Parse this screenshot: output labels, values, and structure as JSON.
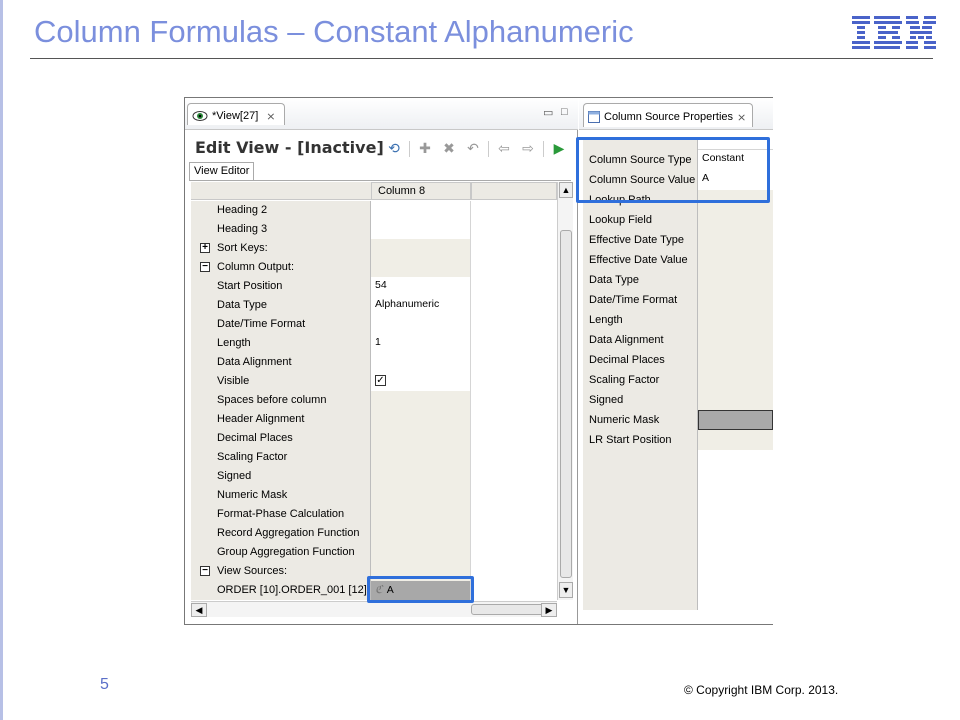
{
  "slide": {
    "title": "Column Formulas – Constant Alphanumeric",
    "logo": "IBM",
    "page_number": "5",
    "copyright": "© Copyright  IBM Corp.  2013."
  },
  "editor": {
    "tab_label": "*View[27]",
    "tab_close": "⨯",
    "title": "Edit View - [Inactive]",
    "subtab": "View Editor",
    "column_header": "Column 8",
    "rows": [
      {
        "label": "Heading 2",
        "value": "",
        "shaded": false
      },
      {
        "label": "Heading 3",
        "value": "",
        "shaded": false
      },
      {
        "label": "Sort Keys:",
        "value": "",
        "shaded": true,
        "toggle": "+"
      },
      {
        "label": "Column Output:",
        "value": "",
        "shaded": true,
        "toggle": "−"
      },
      {
        "label": "Start Position",
        "value": "54",
        "shaded": false
      },
      {
        "label": "Data Type",
        "value": "Alphanumeric",
        "shaded": false
      },
      {
        "label": "Date/Time Format",
        "value": "",
        "shaded": false
      },
      {
        "label": "Length",
        "value": "1",
        "shaded": false
      },
      {
        "label": "Data Alignment",
        "value": "",
        "shaded": false
      },
      {
        "label": "Visible",
        "value": "",
        "shaded": false,
        "checkbox": true
      },
      {
        "label": "Spaces before column",
        "value": "",
        "shaded": true
      },
      {
        "label": "Header Alignment",
        "value": "",
        "shaded": true
      },
      {
        "label": "Decimal Places",
        "value": "",
        "shaded": true
      },
      {
        "label": "Scaling Factor",
        "value": "",
        "shaded": true
      },
      {
        "label": "Signed",
        "value": "",
        "shaded": true
      },
      {
        "label": "Numeric Mask",
        "value": "",
        "shaded": true
      },
      {
        "label": "Format-Phase Calculation",
        "value": "",
        "shaded": true
      },
      {
        "label": "Record Aggregation Function",
        "value": "",
        "shaded": true
      },
      {
        "label": "Group Aggregation Function",
        "value": "",
        "shaded": true
      },
      {
        "label": "View Sources:",
        "value": "",
        "shaded": true,
        "toggle": "−"
      },
      {
        "label": "ORDER [10].ORDER_001 [12]",
        "value": "A",
        "selected": true
      }
    ]
  },
  "properties": {
    "tab_label": "Column Source Properties",
    "tab_close": "⨯",
    "rows": [
      {
        "label": "Column Source Type",
        "value": "Constant",
        "style": "white"
      },
      {
        "label": "Column Source Value",
        "value": "A",
        "style": "white"
      },
      {
        "label": "Lookup Path",
        "value": "",
        "style": "shaded"
      },
      {
        "label": "Lookup Field",
        "value": "",
        "style": "shaded"
      },
      {
        "label": "Effective Date Type",
        "value": "",
        "style": "shaded"
      },
      {
        "label": "Effective Date Value",
        "value": "",
        "style": "shaded"
      },
      {
        "label": "Data Type",
        "value": "",
        "style": "shaded"
      },
      {
        "label": "Date/Time Format",
        "value": "",
        "style": "shaded"
      },
      {
        "label": "Length",
        "value": "",
        "style": "shaded"
      },
      {
        "label": "Data Alignment",
        "value": "",
        "style": "shaded"
      },
      {
        "label": "Decimal Places",
        "value": "",
        "style": "shaded"
      },
      {
        "label": "Scaling Factor",
        "value": "",
        "style": "shaded"
      },
      {
        "label": "Signed",
        "value": "",
        "style": "shaded"
      },
      {
        "label": "Numeric Mask",
        "value": "",
        "style": "dark"
      },
      {
        "label": "LR Start Position",
        "value": "",
        "style": "shaded"
      }
    ],
    "empty_rows": 8
  },
  "colors": {
    "title": "#7b8fdd",
    "highlight": "#2f6fdb",
    "label_bg": "#eceae4"
  }
}
